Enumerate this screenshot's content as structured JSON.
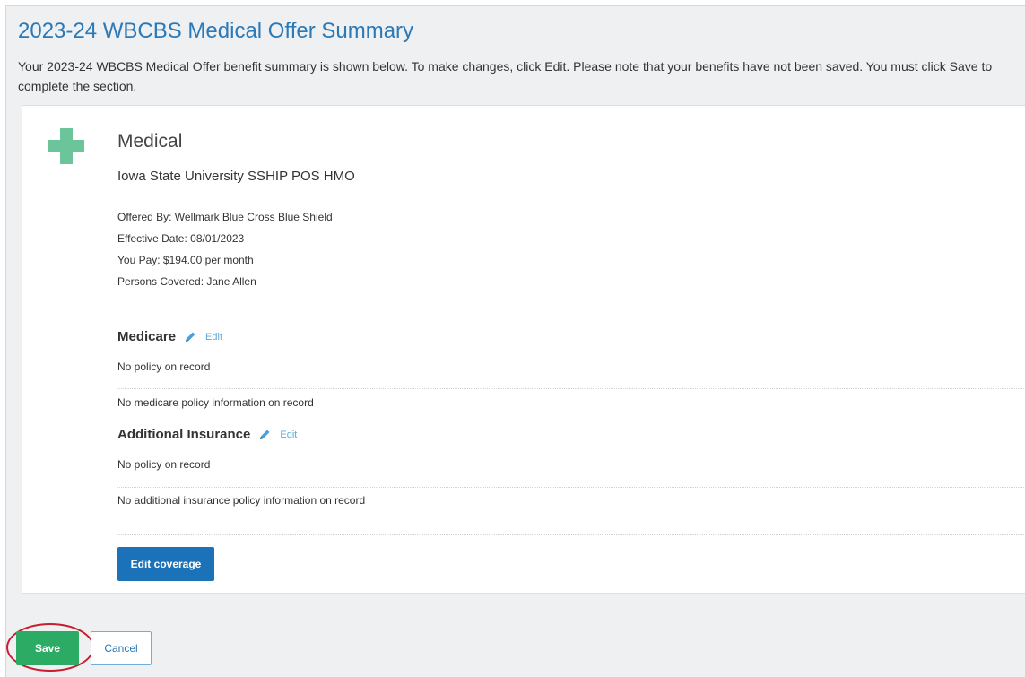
{
  "page": {
    "title": "2023-24 WBCBS Medical Offer Summary",
    "intro": "Your 2023-24 WBCBS Medical Offer benefit summary is shown below. To make changes, click Edit. Please note that your benefits have not been saved. You must click Save to complete the section."
  },
  "benefit": {
    "icon": "medical-cross-icon",
    "icon_color": "#6cc59a",
    "section_title": "Medical",
    "plan_name": "Iowa State University SSHIP POS HMO",
    "details": [
      "Offered By: Wellmark Blue Cross Blue Shield",
      "Effective Date: 08/01/2023",
      "You Pay: $194.00 per month",
      "Persons Covered: Jane Allen"
    ]
  },
  "medicare": {
    "heading": "Medicare",
    "edit_label": "Edit",
    "status": "No policy on record",
    "info": "No medicare policy information on record"
  },
  "additional_insurance": {
    "heading": "Additional Insurance",
    "edit_label": "Edit",
    "status": "No policy on record",
    "info": "No additional insurance policy information on record"
  },
  "actions": {
    "edit_coverage_label": "Edit coverage",
    "save_label": "Save",
    "cancel_label": "Cancel"
  },
  "colors": {
    "title": "#2b79b7",
    "edit_coverage_button": "#1b72b9",
    "save_button": "#2bab63",
    "highlight_ring": "#c61f2f",
    "edit_link": "#5ea8d8"
  }
}
